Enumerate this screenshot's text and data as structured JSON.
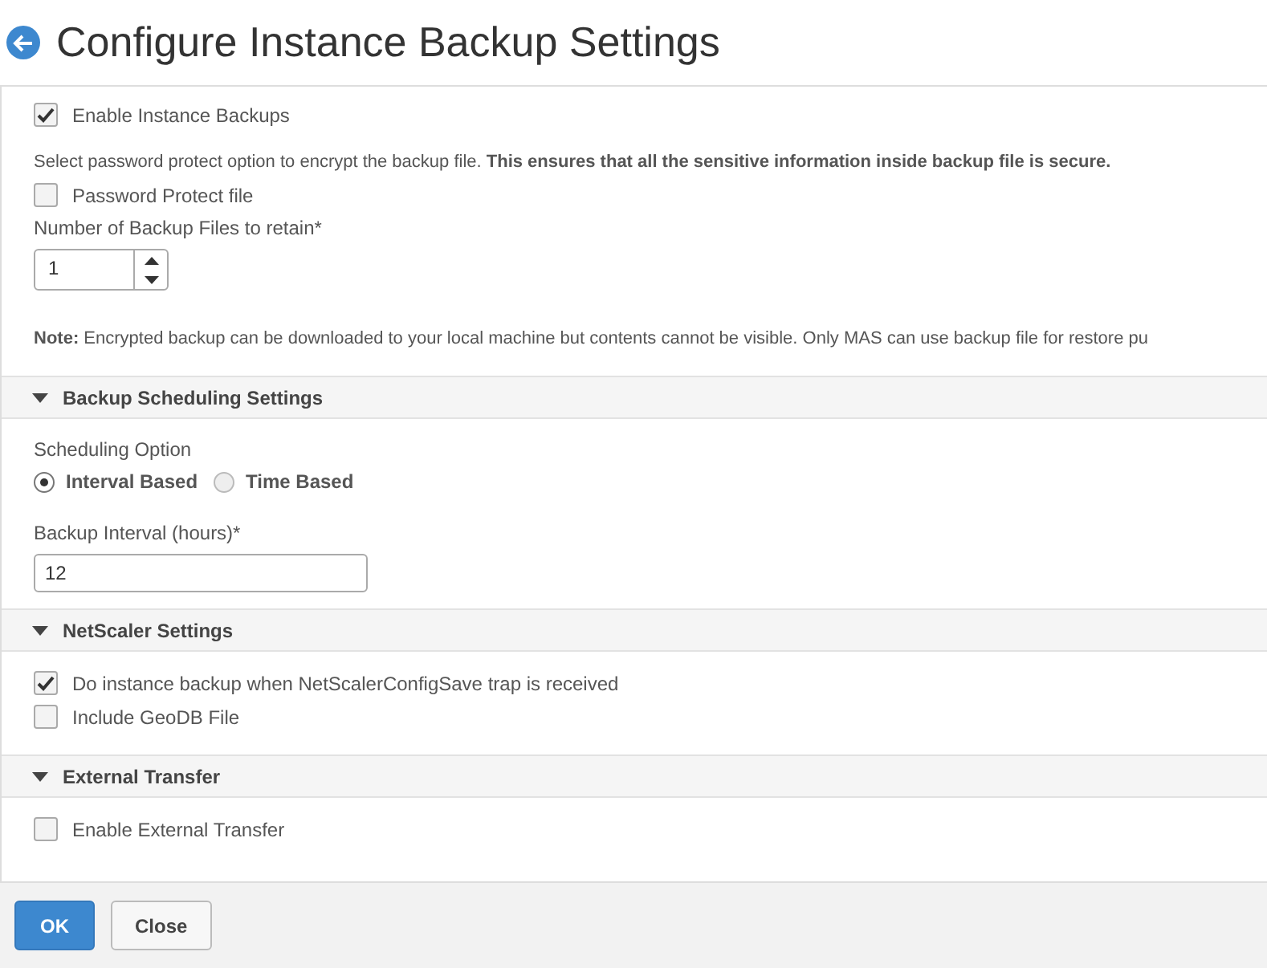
{
  "page": {
    "title": "Configure Instance Backup Settings"
  },
  "sections": [
    {
      "kind": "plain",
      "fields": [
        {
          "kind": "checkbox",
          "label": "Enable Instance Backups",
          "checked": true
        },
        {
          "kind": "paragraph",
          "text": "Select password protect option to encrypt the backup file. **This ensures that all the sensitive information inside backup file is secure.**"
        },
        {
          "kind": "checkbox",
          "label": "Password Protect file",
          "checked": false
        },
        {
          "kind": "spinner",
          "label": "Number of Backup Files to retain*",
          "value": "1"
        },
        {
          "kind": "paragraph",
          "text": "**Note:** Encrypted backup can be downloaded to your local machine but contents cannot be visible. Only MAS can use backup file for restore pu"
        }
      ]
    },
    {
      "kind": "collapsible",
      "title": "Backup Scheduling Settings",
      "expanded": true,
      "fields": [
        {
          "kind": "label",
          "text": "Scheduling Option"
        },
        {
          "kind": "radio_group",
          "options": [
            {
              "label": "Interval Based",
              "selected": true
            },
            {
              "label": "Time Based",
              "selected": false
            }
          ]
        },
        {
          "kind": "text_input",
          "label": "Backup Interval (hours)*",
          "value": "12"
        }
      ]
    },
    {
      "kind": "collapsible",
      "title": "NetScaler Settings",
      "expanded": true,
      "fields": [
        {
          "kind": "checkbox",
          "label": "Do instance backup when NetScalerConfigSave trap is received",
          "checked": true
        },
        {
          "kind": "checkbox",
          "label": "Include GeoDB File",
          "checked": false
        }
      ]
    },
    {
      "kind": "collapsible",
      "title": "External Transfer",
      "expanded": true,
      "fields": [
        {
          "kind": "checkbox",
          "label": "Enable External Transfer",
          "checked": false
        }
      ]
    }
  ],
  "buttons": [
    {
      "label": "OK",
      "kind": "primary"
    },
    {
      "label": "Close",
      "kind": "secondary"
    }
  ]
}
